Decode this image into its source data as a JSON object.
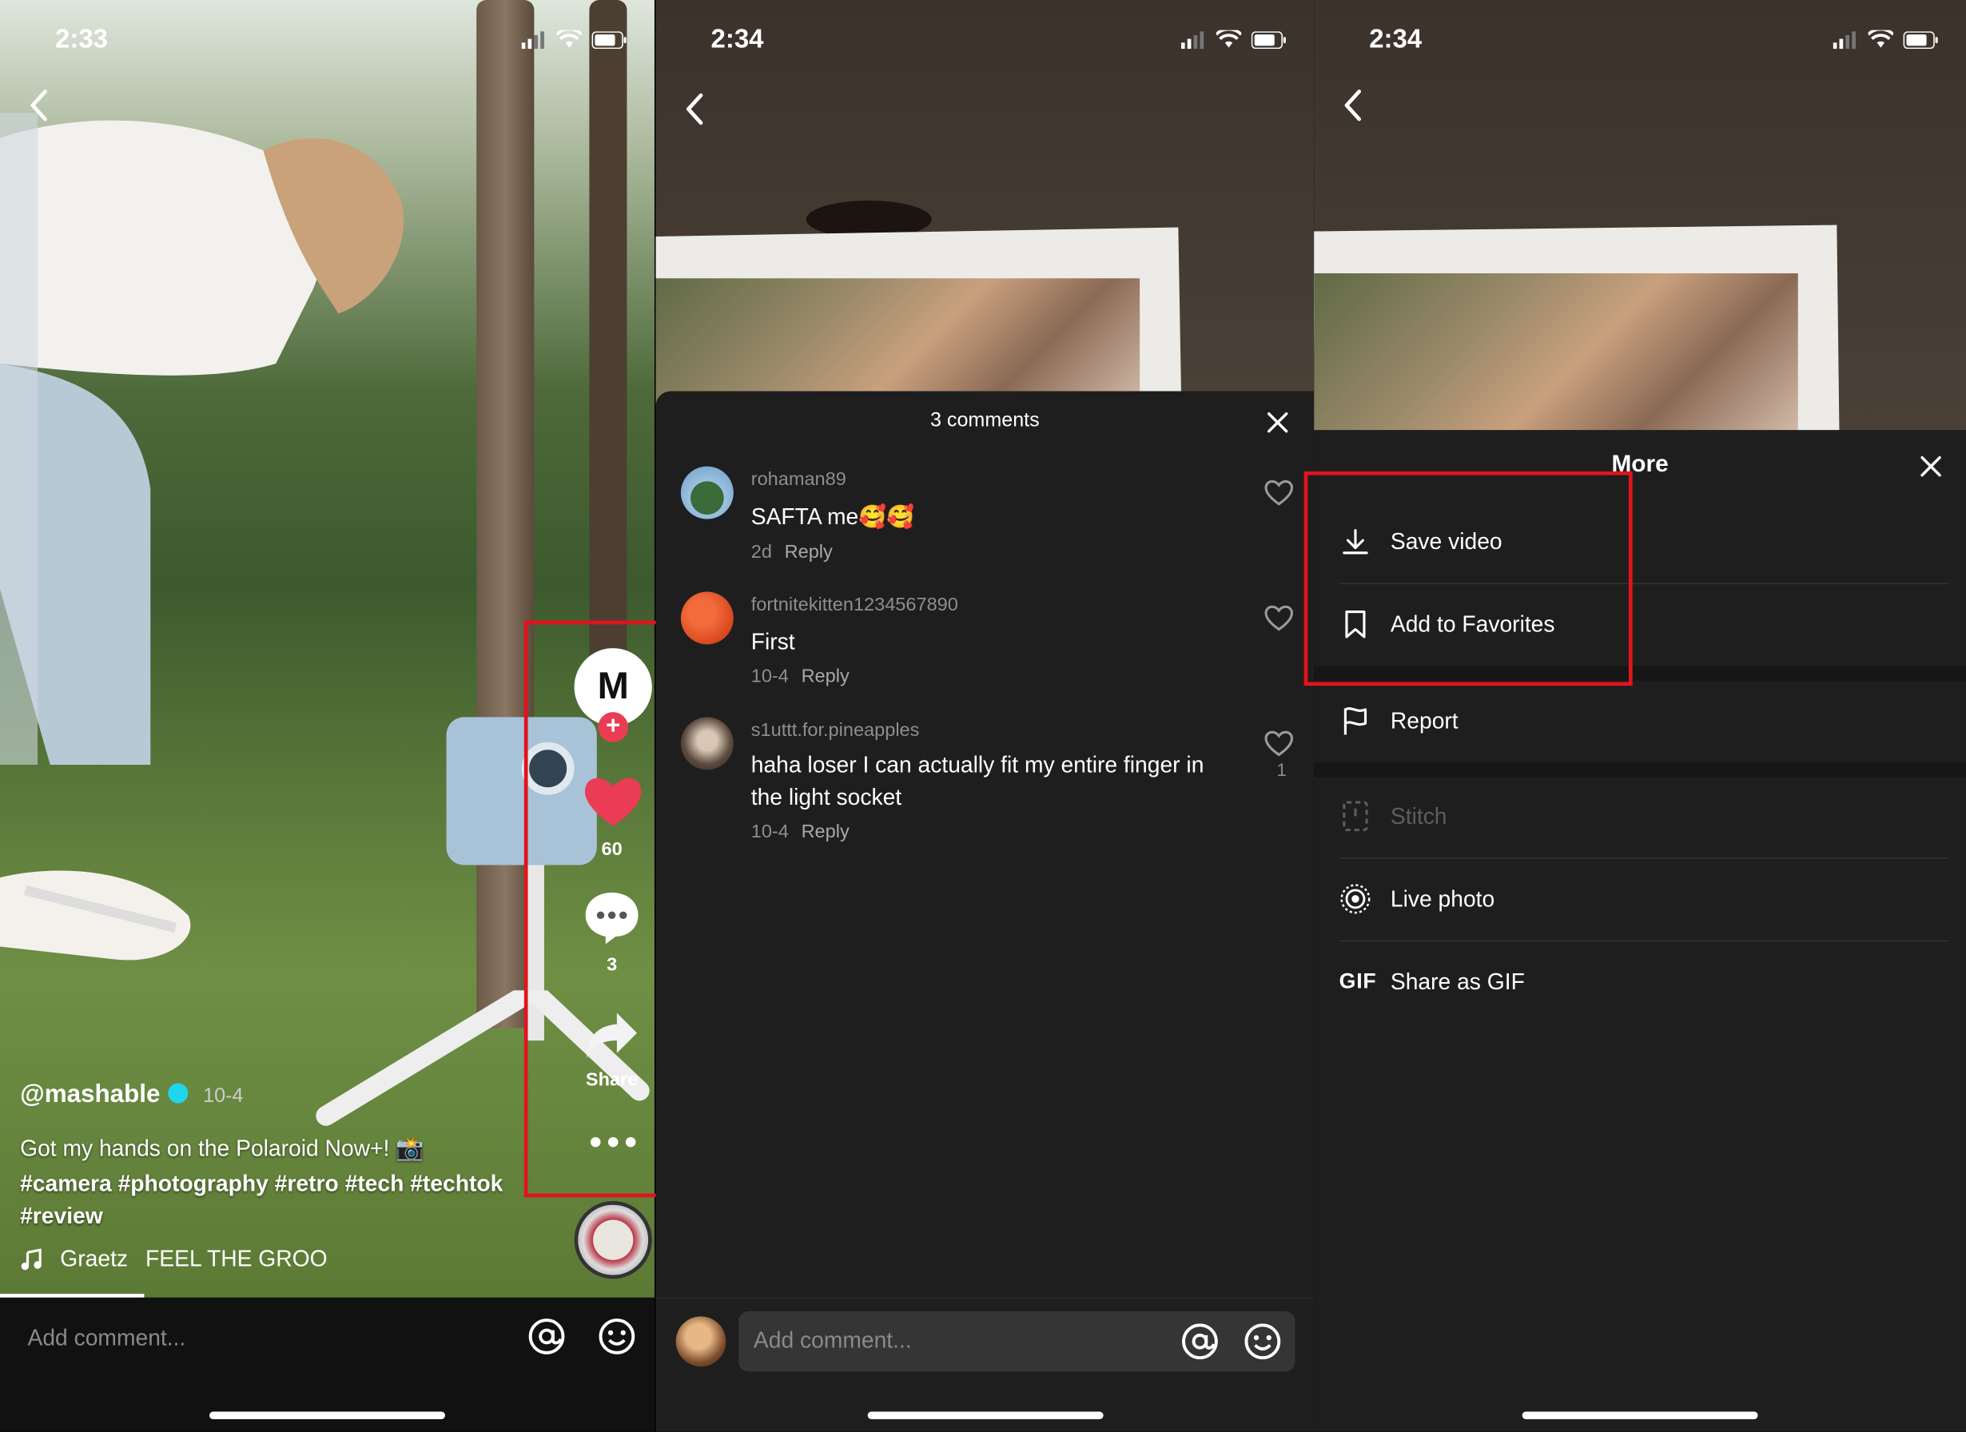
{
  "panel1": {
    "status_time": "2:33",
    "creator_handle": "@mashable",
    "post_date": "10-4",
    "caption_line1": "Got my hands on the Polaroid Now+! 📸",
    "caption_line2": "#camera #photography #retro #tech #techtok",
    "caption_line3": "#review",
    "music_artist": "Graetz",
    "music_title": "FEEL THE GROO",
    "likes_count": "60",
    "comments_count": "3",
    "share_label": "Share",
    "avatar_letter": "M",
    "comment_placeholder": "Add comment..."
  },
  "panel2": {
    "status_time": "2:34",
    "comments_title": "3 comments",
    "comments": [
      {
        "user": "rohaman89",
        "text": "SAFTA me🥰🥰",
        "age": "2d",
        "reply": "Reply",
        "likes": ""
      },
      {
        "user": "fortnitekitten1234567890",
        "text": "First",
        "age": "10-4",
        "reply": "Reply",
        "likes": ""
      },
      {
        "user": "s1uttt.for.pineapples",
        "text": "haha loser I can actually fit my entire finger in the light socket",
        "age": "10-4",
        "reply": "Reply",
        "likes": "1"
      }
    ],
    "comment_placeholder": "Add comment..."
  },
  "panel3": {
    "status_time": "2:34",
    "sheet_title": "More",
    "items": [
      {
        "label": "Save video",
        "icon": "download-icon",
        "enabled": true
      },
      {
        "label": "Add to Favorites",
        "icon": "bookmark-icon",
        "enabled": true
      },
      {
        "label": "Report",
        "icon": "flag-icon",
        "enabled": true
      },
      {
        "label": "Stitch",
        "icon": "stitch-icon",
        "enabled": false
      },
      {
        "label": "Live photo",
        "icon": "live-photo-icon",
        "enabled": true
      },
      {
        "label": "Share as GIF",
        "icon": "gif-icon",
        "enabled": true,
        "icon_text": "GIF"
      }
    ]
  },
  "colors": {
    "highlight_box": "#e1141c",
    "like_red": "#ea3c55",
    "sheet_bg": "#1e1e1e",
    "muted_text": "#8e8e8e"
  }
}
